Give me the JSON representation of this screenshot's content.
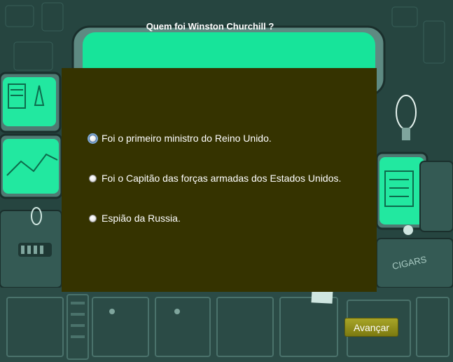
{
  "question": {
    "title": "Quem foi Winston Churchill ?"
  },
  "options": [
    {
      "label": "Foi o primeiro ministro do Reino Unido."
    },
    {
      "label": "Foi o Capitão das forças armadas dos Estados Unidos."
    },
    {
      "label": "Espião da Russia."
    }
  ],
  "background": {
    "sign_text": "CIGARS"
  },
  "next_button": {
    "label": "Avançar"
  },
  "colors": {
    "panel": "#353300",
    "background": "#264540",
    "screen_green": "#17e49a",
    "button": "#8f8d1a"
  }
}
